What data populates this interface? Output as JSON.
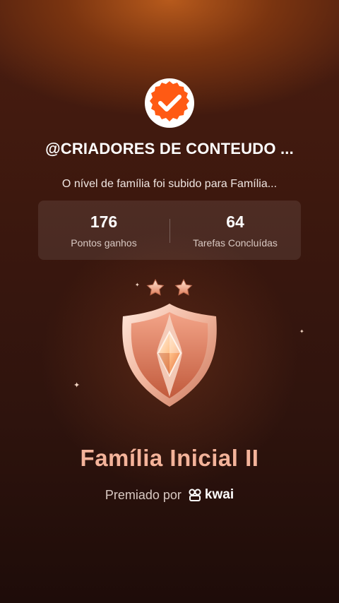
{
  "header": {
    "avatar_icon": "orange-badge-checkmark-icon",
    "username": "@CRIADORES DE CONTEUDO ...",
    "message": "O nível de família foi subido para Família..."
  },
  "stats": {
    "points_value": "176",
    "points_label": "Pontos ganhos",
    "tasks_value": "64",
    "tasks_label": "Tarefas Concluídas"
  },
  "badge": {
    "icon": "family-level-shield-icon",
    "stars": 2,
    "level_name": "Família Inicial II"
  },
  "footer": {
    "awarded_by_label": "Premiado por",
    "brand_name": "kwai",
    "brand_icon": "kwai-logo-icon"
  },
  "colors": {
    "accent_orange": "#ff5a14",
    "level_text": "#f4b39a",
    "background_dark": "#2e130d"
  }
}
